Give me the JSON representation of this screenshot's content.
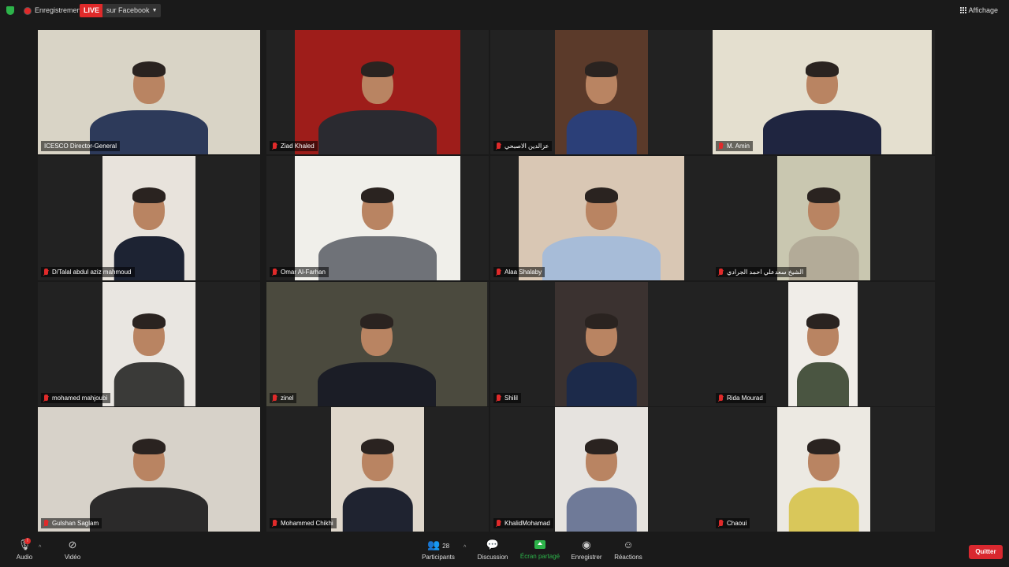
{
  "topbar": {
    "recording_label": "Enregistrement",
    "live_label": "LIVE",
    "live_target": "sur Facebook",
    "view_label": "Affichage"
  },
  "participants": [
    {
      "name": "ICESCO Director-General",
      "active": true,
      "bg": "#d9d4c6",
      "shirt": "#2d3a5a"
    },
    {
      "name": "Ziad Khaled",
      "bg": "#9e1d1a",
      "shirt": "#2a2a30"
    },
    {
      "name": "عزالدين الاصبحي",
      "bg": "#5b3a2a",
      "shirt": "#2b3f78"
    },
    {
      "name": "M. Amin",
      "bg": "#e4dfcf",
      "shirt": "#1f2540"
    },
    {
      "name": "D/Talal abdul aziz mahmoud",
      "bg": "#e8e3dc",
      "shirt": "#1d2333"
    },
    {
      "name": "Omar Al-Farhan",
      "bg": "#f0efea",
      "shirt": "#6f7278"
    },
    {
      "name": "Alaa Shalaby",
      "bg": "#d9c7b4",
      "shirt": "#a7bcd8"
    },
    {
      "name": "الشيخ سعدعلي احمد الجرادي",
      "bg": "#c9c7b0",
      "shirt": "#b3ab98"
    },
    {
      "name": "mohamed mahjoubi",
      "bg": "#e9e6e1",
      "shirt": "#3a3a38"
    },
    {
      "name": "zinel",
      "bg": "#4b4a3e",
      "shirt": "#1b1d26"
    },
    {
      "name": "Shilil",
      "bg": "#3b3230",
      "shirt": "#1c2a4a"
    },
    {
      "name": "Rida Mourad",
      "bg": "#f0ede8",
      "shirt": "#4a5541"
    },
    {
      "name": "Gulshan Saglam",
      "bg": "#d7d2c9",
      "shirt": "#2b2a2a"
    },
    {
      "name": "Mohammed Chikhi",
      "bg": "#dfd7cb",
      "shirt": "#1f2330"
    },
    {
      "name": "KhalidMohamad",
      "bg": "#e6e3df",
      "shirt": "#6f7a98"
    },
    {
      "name": "Chaoui",
      "bg": "#ece9e2",
      "shirt": "#d9c75a"
    }
  ],
  "toolbar": {
    "audio_label": "Audio",
    "audio_badge": "!",
    "video_label": "Vidéo",
    "participants_label": "Participants",
    "participants_count": "28",
    "chat_label": "Discussion",
    "share_label": "Écran partagé",
    "record_label": "Enregistrer",
    "reactions_label": "Réactions",
    "quit_label": "Quitter"
  },
  "colors": {
    "background": "#1a1a1a",
    "live_red": "#e02a2a",
    "share_green": "#2db34a",
    "active_speaker": "#d8e04a",
    "quit_red": "#d9282f"
  }
}
